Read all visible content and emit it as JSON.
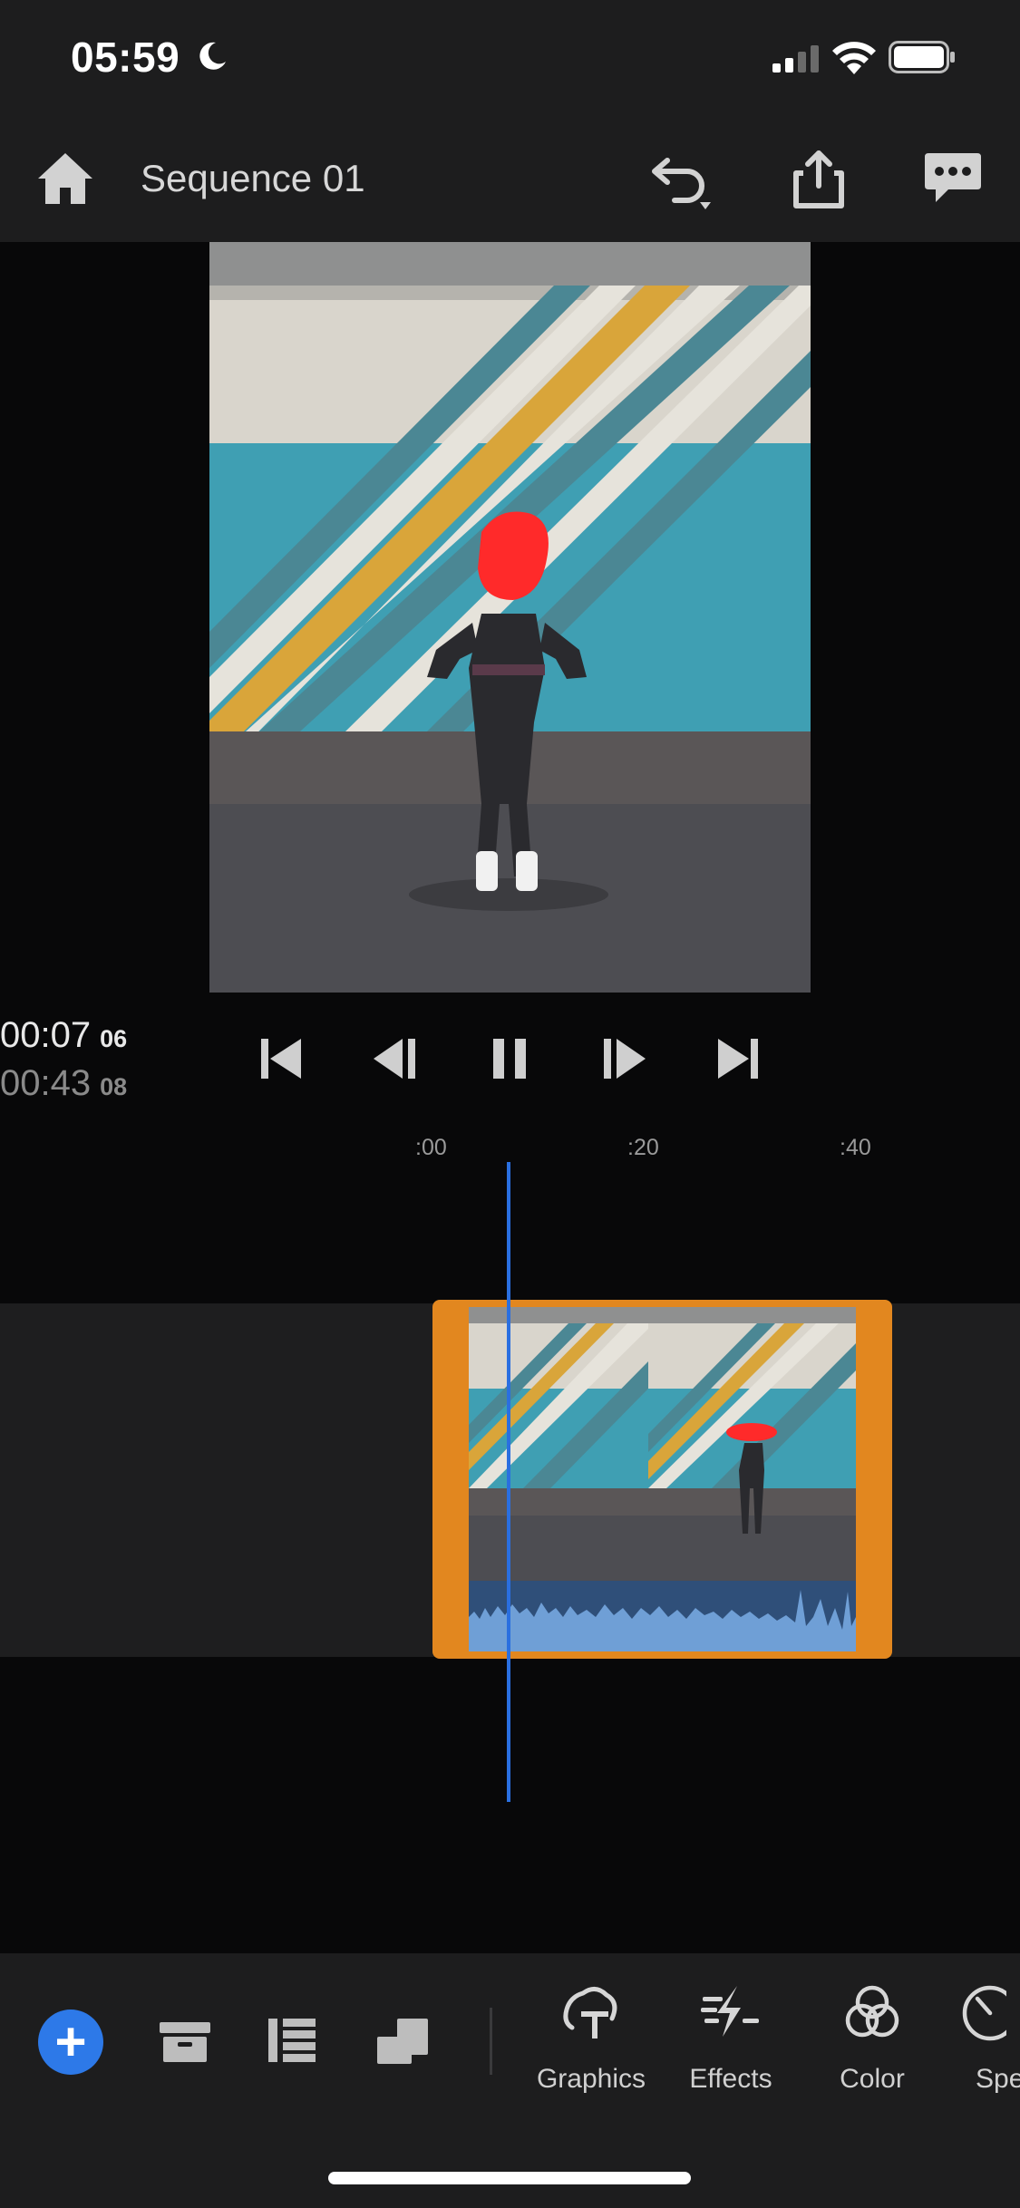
{
  "status": {
    "time": "05:59"
  },
  "header": {
    "title": "Sequence 01"
  },
  "timecodes": {
    "current": "00:07",
    "current_frames": "06",
    "duration": "00:43",
    "duration_frames": "08"
  },
  "ruler": {
    "labels": [
      ":00",
      ":20",
      ":40"
    ]
  },
  "toolbar": {
    "tools": [
      {
        "label": "Graphics",
        "icon": "graphics-icon"
      },
      {
        "label": "Effects",
        "icon": "effects-icon"
      },
      {
        "label": "Color",
        "icon": "color-icon"
      },
      {
        "label": "Spe",
        "icon": "speed-icon"
      }
    ]
  },
  "colors": {
    "accent": "#2d79e8",
    "clip": "#e2871f",
    "playhead": "#2a6fe0",
    "waveform": "#6f9fd6"
  }
}
